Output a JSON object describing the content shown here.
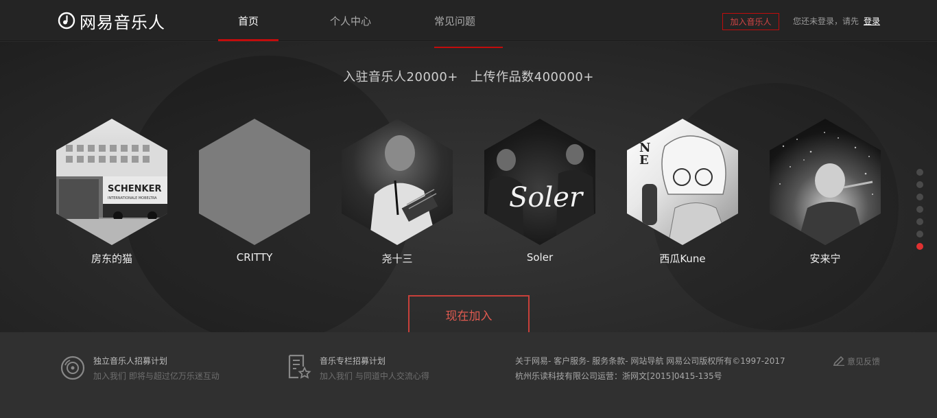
{
  "header": {
    "logo_text": "网易音乐人",
    "tabs": [
      {
        "label": "首页",
        "active": true
      },
      {
        "label": "个人中心",
        "active": false
      },
      {
        "label": "常见问题",
        "active": false
      }
    ],
    "join_button": "加入音乐人",
    "login_hint": "您还未登录，请先",
    "login_link": "登录"
  },
  "hero": {
    "stat_musicians": "入驻音乐人20000+",
    "stat_works": "上传作品数400000+",
    "musicians": [
      {
        "name": "房东的猫"
      },
      {
        "name": "CRITTY"
      },
      {
        "name": "尧十三"
      },
      {
        "name": "Soler"
      },
      {
        "name": "西瓜Kune"
      },
      {
        "name": "安来宁"
      }
    ],
    "hex_text_schenker": "SCHENKER",
    "hex_text_soler": "Soler",
    "carousel_pages": 7,
    "carousel_active_page": 7,
    "join_now": "现在加入"
  },
  "footer": {
    "plan1_title": "独立音乐人招募计划",
    "plan1_sub": "加入我们 即将与超过亿万乐迷互动",
    "plan2_title": "音乐专栏招募计划",
    "plan2_sub": "加入我们 与同道中人交流心得",
    "links_line": "关于网易- 客户服务- 服务条款- 网站导航 网易公司版权所有©1997-2017",
    "company_line": "杭州乐读科技有限公司运营：浙网文[2015]0415-135号",
    "feedback": "意见反馈"
  },
  "colors": {
    "accent": "#c20c0c",
    "header_bg": "#242424",
    "footer_bg": "#303030",
    "active_dot": "#e03131"
  }
}
